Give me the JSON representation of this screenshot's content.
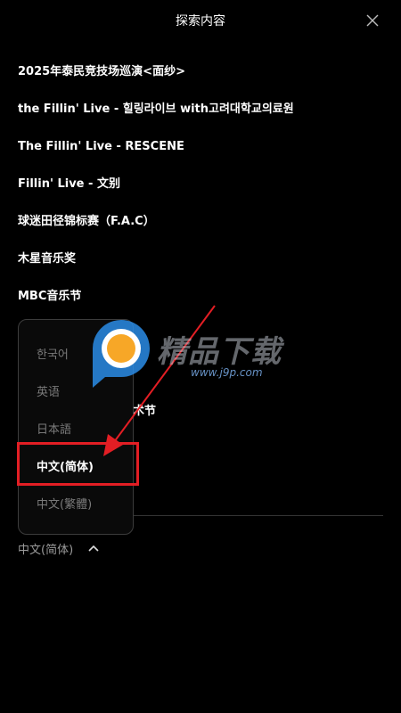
{
  "header": {
    "title": "探索内容"
  },
  "items": [
    "2025年泰民竞技场巡演<面纱>",
    "the Fillin' Live - 힐링라이브 with고려대학교의료원",
    "The Fillin' Live - RESCENE",
    "Fillin' Live - 文别",
    "球迷田径锦标赛（F.A.C）",
    "木星音乐奖",
    "MBC音乐节"
  ],
  "partial_item_tail": "术节",
  "language_menu": {
    "options": [
      "한국어",
      "英语",
      "日本語",
      "中文(简体)",
      "中文(繁體)"
    ],
    "selected_index": 3
  },
  "language_selector": {
    "current": "中文(简体)"
  },
  "watermark": {
    "text": "精品下载",
    "url": "www.j9p.com"
  },
  "colors": {
    "background": "#000000",
    "annotation_red": "#e31e24",
    "watermark_orange": "#f7a21b",
    "watermark_blue": "#2a8ce6"
  }
}
